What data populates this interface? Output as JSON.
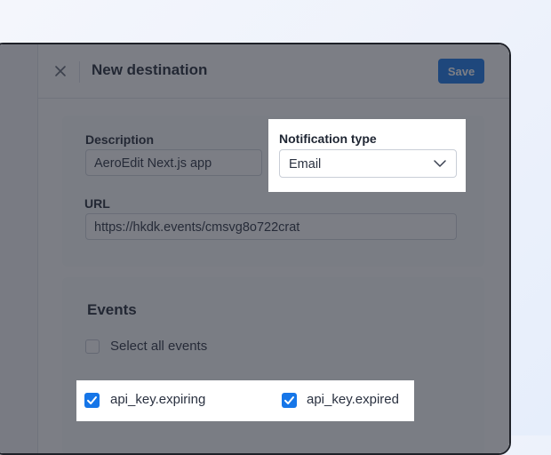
{
  "modal": {
    "title": "New destination",
    "save_label": "Save"
  },
  "form": {
    "description": {
      "label": "Description",
      "value": "AeroEdit Next.js app"
    },
    "notification_type": {
      "label": "Notification type",
      "value": "Email"
    },
    "url": {
      "label": "URL",
      "value": "https://hkdk.events/cmsvg8o722crat"
    }
  },
  "events": {
    "heading": "Events",
    "select_all_label": "Select all events",
    "items": [
      {
        "label": "api_key.expiring",
        "checked": true
      },
      {
        "label": "api_key.expired",
        "checked": true
      }
    ]
  },
  "icons": {
    "close": "close-icon",
    "chevron": "chevron-down-icon",
    "check": "check-icon"
  },
  "colors": {
    "accent": "#1676e8",
    "overlay": "#242834",
    "window_border": "#1e2128",
    "text": "#1f2633"
  }
}
